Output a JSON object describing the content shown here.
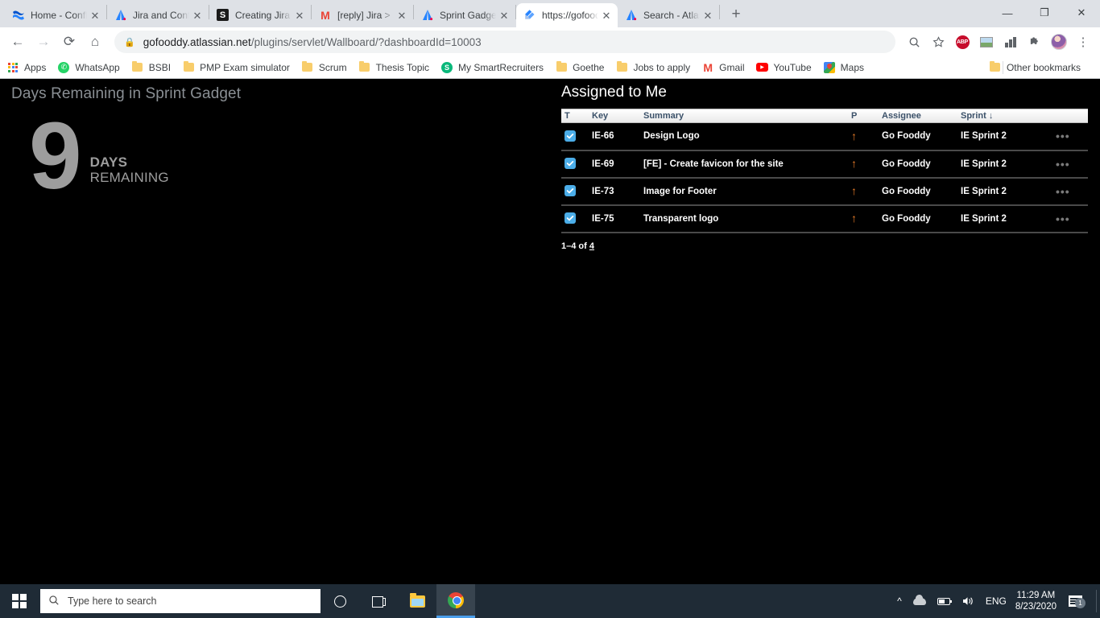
{
  "browser": {
    "tabs": [
      {
        "title": "Home - Confluence",
        "favicon": "confluence-icon",
        "active": false
      },
      {
        "title": "Jira and Confluence",
        "favicon": "jira-icon",
        "active": false
      },
      {
        "title": "Creating Jira issues",
        "favicon": "slack-icon",
        "active": false
      },
      {
        "title": "[reply] Jira > Sprint",
        "favicon": "gmail-icon",
        "active": false
      },
      {
        "title": "Sprint Gadget (rem",
        "favicon": "jira-icon",
        "active": false
      },
      {
        "title": "https://gofooddy.a",
        "favicon": "jira-software-icon",
        "active": true
      },
      {
        "title": "Search - Atlassian",
        "favicon": "jira-icon",
        "active": false
      }
    ],
    "new_tab_label": "+",
    "close_label": "✕",
    "window_controls": {
      "minimize": "—",
      "maximize": "❐",
      "close": "✕"
    },
    "nav": {
      "back": "←",
      "forward": "→",
      "reload": "⟳",
      "home": "⌂"
    },
    "address": {
      "lock_icon": "lock-icon",
      "host": "gofooddy.atlassian.net",
      "path": "/plugins/servlet/Wallboard/?dashboardId=10003"
    },
    "toolbar_icons": [
      {
        "name": "zoom-search-icon",
        "glyph": "⌕"
      },
      {
        "name": "bookmark-star-icon",
        "glyph": "☆"
      },
      {
        "name": "adblock-plus-icon",
        "label": "ABP"
      },
      {
        "name": "image-extension-icon",
        "glyph": ""
      },
      {
        "name": "chart-extension-icon",
        "glyph": ""
      },
      {
        "name": "extensions-puzzle-icon",
        "glyph": "🧩"
      },
      {
        "name": "profile-avatar",
        "glyph": ""
      },
      {
        "name": "chrome-menu-icon",
        "glyph": "⋮"
      }
    ],
    "bookmarks": [
      {
        "label": "Apps",
        "icon": "apps-grid-icon"
      },
      {
        "label": "WhatsApp",
        "icon": "whatsapp-icon"
      },
      {
        "label": "BSBI",
        "icon": "folder-icon"
      },
      {
        "label": "PMP Exam simulator",
        "icon": "folder-icon"
      },
      {
        "label": "Scrum",
        "icon": "folder-icon"
      },
      {
        "label": "Thesis Topic",
        "icon": "folder-icon"
      },
      {
        "label": "My SmartRecruiters",
        "icon": "smartrecruiters-icon"
      },
      {
        "label": "Goethe",
        "icon": "folder-icon"
      },
      {
        "label": "Jobs to apply",
        "icon": "folder-icon"
      },
      {
        "label": "Gmail",
        "icon": "gmail-icon"
      },
      {
        "label": "YouTube",
        "icon": "youtube-icon"
      },
      {
        "label": "Maps",
        "icon": "maps-icon"
      }
    ],
    "other_bookmarks": {
      "label": "Other bookmarks",
      "icon": "folder-icon"
    }
  },
  "wallboard": {
    "days_gadget": {
      "title": "Days Remaining in Sprint Gadget",
      "number": "9",
      "label_line1": "DAYS",
      "label_line2": "REMAINING"
    },
    "assigned_gadget": {
      "title": "Assigned to Me",
      "columns": [
        "T",
        "Key",
        "Summary",
        "P",
        "Assignee",
        "Sprint",
        ""
      ],
      "sort_column": "Sprint",
      "sort_arrow": "↓",
      "rows": [
        {
          "type": "Task",
          "key": "IE-66",
          "summary": "Design Logo",
          "priority": "↑",
          "assignee": "Go Fooddy",
          "sprint": "IE Sprint 2",
          "actions": "•••"
        },
        {
          "type": "Task",
          "key": "IE-69",
          "summary": "[FE] - Create favicon for the site",
          "priority": "↑",
          "assignee": "Go Fooddy",
          "sprint": "IE Sprint 2",
          "actions": "•••"
        },
        {
          "type": "Task",
          "key": "IE-73",
          "summary": "Image for Footer",
          "priority": "↑",
          "assignee": "Go Fooddy",
          "sprint": "IE Sprint 2",
          "actions": "•••"
        },
        {
          "type": "Task",
          "key": "IE-75",
          "summary": "Transparent logo",
          "priority": "↑",
          "assignee": "Go Fooddy",
          "sprint": "IE Sprint 2",
          "actions": "•••"
        }
      ],
      "pagination_prefix": "1–4 of ",
      "pagination_total": "4"
    },
    "colors": {
      "background": "#000000",
      "gadget_title": "#8a8f94",
      "days_number": "#9d9d9d",
      "priority_arrow": "#e87c28",
      "type_icon": "#4bade8"
    }
  },
  "taskbar": {
    "start_label": "start-button",
    "search_placeholder": "Type here to search",
    "buttons": [
      {
        "name": "cortana-button",
        "label": ""
      },
      {
        "name": "task-view-button",
        "label": ""
      },
      {
        "name": "file-explorer-button",
        "label": ""
      },
      {
        "name": "chrome-taskbar-button",
        "label": ""
      }
    ],
    "tray": {
      "chevron": "^",
      "language": "ENG",
      "time": "11:29 AM",
      "date": "8/23/2020",
      "notification_count": "1"
    }
  }
}
